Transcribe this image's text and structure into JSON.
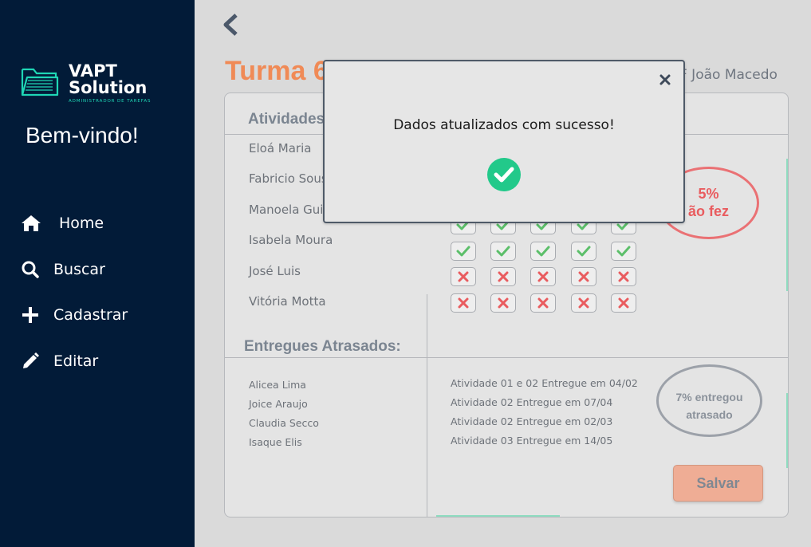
{
  "brand": {
    "line1": "VAPT",
    "line2": "Solution",
    "subtitle": "ADMINISTRADOR DE TAREFAS"
  },
  "sidebar": {
    "welcome": "Bem-vindo!",
    "items": [
      {
        "label": "Home",
        "icon": "home-icon"
      },
      {
        "label": "Buscar",
        "icon": "search-icon"
      },
      {
        "label": "Cadastrar",
        "icon": "plus-icon"
      },
      {
        "label": "Editar",
        "icon": "pencil-icon"
      }
    ]
  },
  "header": {
    "title": "Turma 6",
    "teacher": "F João Macedo"
  },
  "activities": {
    "title": "Atividades",
    "students": [
      "Eloá Maria",
      "Fabricio Sous",
      "Manoela Guin",
      "Isabela Moura",
      "José Luis",
      "Vitória Motta"
    ],
    "grid_rows": [
      [
        "check",
        "check",
        "check",
        "check",
        "check"
      ],
      [
        "check",
        "check",
        "check",
        "check",
        "check"
      ],
      [
        "cross",
        "cross",
        "cross",
        "cross",
        "cross"
      ],
      [
        "cross",
        "cross",
        "cross",
        "cross",
        "cross"
      ]
    ],
    "summary_line1": "5%",
    "summary_line2": "ão fez"
  },
  "late": {
    "title": "Entregues Atrasados:",
    "students": [
      "Alicea Lima",
      "Joice Araujo",
      "Claudia Secco",
      "Isaque Elis"
    ],
    "activities": [
      "Atividade 01 e 02 Entregue em 04/02",
      "Atividade 02 Entregue em 07/04",
      "Atividade 02 Entregue em 02/03",
      "Atividade 03 Entregue em 14/05"
    ],
    "summary_line1": "7% entregou",
    "summary_line2": "atrasado"
  },
  "save_label": "Salvar",
  "modal": {
    "message": "Dados atualizados com sucesso!"
  },
  "colors": {
    "sidebar": "#021b38",
    "accent_title": "#f08a56",
    "check": "#5cbf6a",
    "cross": "#e95c5f",
    "success": "#22c98a",
    "save_button": "#efad95"
  }
}
